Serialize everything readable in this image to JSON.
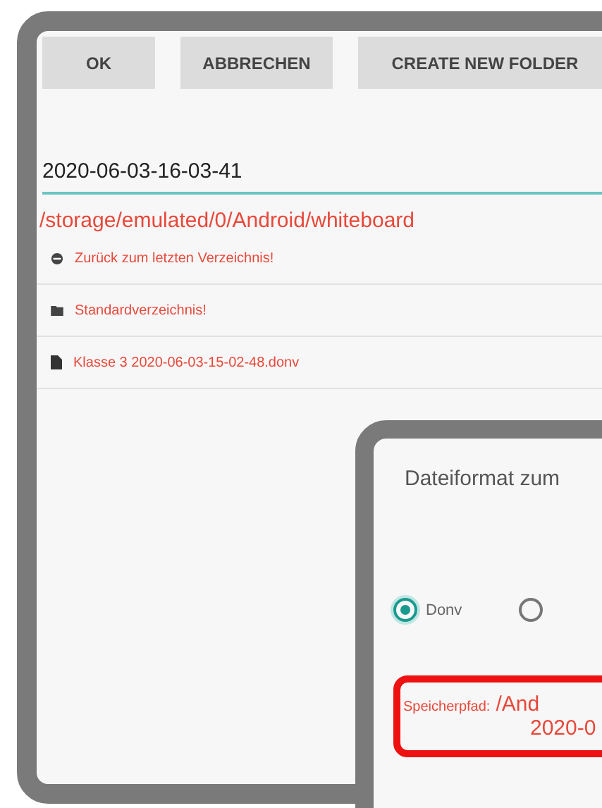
{
  "file_dialog": {
    "buttons": [
      "OK",
      "ABBRECHEN",
      "CREATE NEW FOLDER"
    ],
    "filename": {
      "value": "2020-06-03-16-03-41"
    },
    "path": "/storage/emulated/0/Android/whiteboard",
    "items": [
      {
        "kind": "back",
        "label": "Zurück zum letzten Verzeichnis!"
      },
      {
        "kind": "folder",
        "label": "Standardverzeichnis!"
      },
      {
        "kind": "file",
        "label": "Klasse 3 2020-06-03-15-02-48.donv"
      }
    ]
  },
  "format_dialog": {
    "title": "Dateiformat zum",
    "options": [
      {
        "label": "Donv",
        "selected": true
      },
      {
        "selected": false
      }
    ],
    "save_path": {
      "label": "Speicherpfad:",
      "value": "/And",
      "value_line_2": "2020-0"
    }
  }
}
